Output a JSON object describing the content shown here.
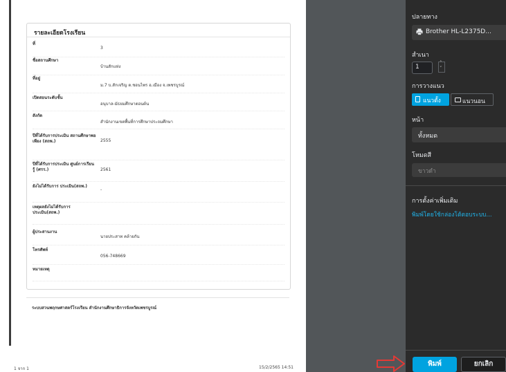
{
  "preview": {
    "card_title": "รายละเอียดโรงเรียน",
    "rows": [
      {
        "label": "ที่",
        "value": "3"
      },
      {
        "label": "ชื่อสถานศึกษา",
        "value": "บ้านสักแห่ง"
      },
      {
        "label": "ที่อยู่",
        "value": "ม.7 บ.สักเจริญ ต.ชอนไพร อ.เมือง จ.เพชรบูรณ์"
      },
      {
        "label": "เปิดสอนระดับชั้น",
        "value": "อนุบาล-มัธยมศึกษาตอนต้น"
      },
      {
        "label": "สังกัด",
        "value": "สำนักงานเขตพื้นที่การศึกษาประถมศึกษา"
      },
      {
        "label": "ปีที่ได้รับการประเมิน สถานศึกษาพอเพียง (สถพ.)",
        "value": "2555"
      },
      {
        "label": "ปีที่ได้รับการประเมิน ศูนย์การเรียนรู้ (ศรร.)",
        "value": "2561"
      },
      {
        "label": "ยังไม่ได้รับการ ประเมิน(สถพ.)",
        "value": "-"
      },
      {
        "label": "เหตุผลยังไม่ได้รับการ ประเมิน(สถพ.)",
        "value": ""
      },
      {
        "label": "ผู้ประสานงาน",
        "value": "นายประสาท คล้ายกัน"
      },
      {
        "label": "โทรศัพท์",
        "value": "056-748669"
      },
      {
        "label": "หมายเหตุ",
        "value": ""
      }
    ],
    "footer": "ระบบสวนพฤกษศาสตร์โรงเรียน  สำนักงานศึกษาธิการจังหวัดเพชรบูรณ์",
    "page_count": "1 จาก 1",
    "print_time": "15/2/2565 14:51"
  },
  "panel": {
    "destination_label": "ปลายทาง",
    "printer_name": "Brother HL-L2375D...",
    "copies_label": "สำเนา",
    "copies_value": "1",
    "orientation_label": "การวางแนว",
    "portrait_label": "แนวตั้ง",
    "landscape_label": "แนวนอน",
    "pages_label": "หน้า",
    "pages_value": "ทั้งหมด",
    "color_label": "โหมดสี",
    "color_value": "ขาวดำ",
    "more_settings_label": "การตั้งค่าเพิ่มเติม",
    "system_dialog_link": "พิมพ์โดยใช้กล่องโต้ตอบระบบ...",
    "print_label": "พิมพ์",
    "cancel_label": "ยกเลิก"
  },
  "colors": {
    "accent": "#00a3e0",
    "panel_bg": "#2b2b2b",
    "gutter_bg": "#525659",
    "arrow": "#e53935"
  },
  "icons": [
    "printer-icon",
    "portrait-icon",
    "landscape-icon",
    "dropdown-chevron-icon",
    "red-arrow-icon"
  ]
}
